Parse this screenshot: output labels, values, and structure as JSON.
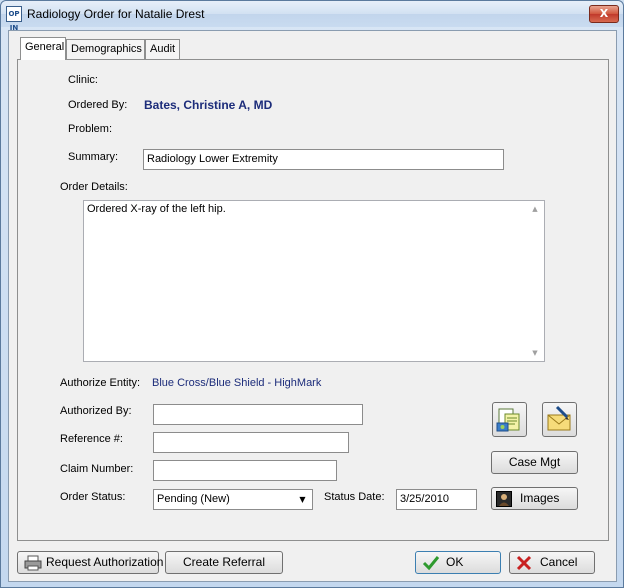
{
  "window": {
    "title": "Radiology Order for Natalie Drest",
    "app_icon_text": "OP IN",
    "close_glyph": "X"
  },
  "tabs": [
    {
      "label": "General"
    },
    {
      "label": "Demographics"
    },
    {
      "label": "Audit"
    }
  ],
  "general": {
    "clinic_label": "Clinic:",
    "ordered_by_label": "Ordered By:",
    "ordered_by_value": "Bates, Christine A, MD",
    "problem_label": "Problem:",
    "summary_label": "Summary:",
    "summary_value": "Radiology Lower Extremity",
    "order_details_label": "Order Details:",
    "order_details_value": "Ordered X-ray of the left hip.",
    "authorize_entity_label": "Authorize Entity:",
    "authorize_entity_value": "Blue Cross/Blue Shield - HighMark",
    "authorized_by_label": "Authorized By:",
    "authorized_by_value": "",
    "reference_label": "Reference #:",
    "reference_value": "",
    "claim_number_label": "Claim Number:",
    "claim_number_value": "",
    "order_status_label": "Order Status:",
    "order_status_value": "Pending (New)",
    "status_date_label": "Status Date:",
    "status_date_value": "3/25/2010",
    "case_mgt_label": "Case Mgt",
    "images_label": "Images"
  },
  "footer": {
    "request_authorization_label": "Request Authorization",
    "create_referral_label": "Create Referral",
    "ok_label": "OK",
    "cancel_label": "Cancel"
  },
  "colors": {
    "link_blue": "#1c2c7a",
    "ok_green": "#2e9a2e",
    "cancel_red": "#c82020"
  }
}
